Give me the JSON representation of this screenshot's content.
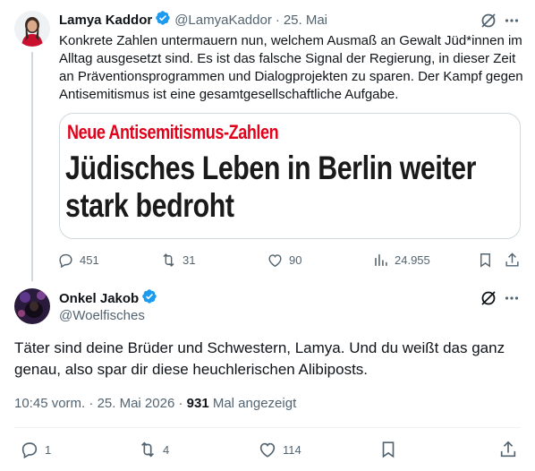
{
  "tweet1": {
    "display_name": "Lamya Kaddor",
    "handle": "@LamyaKaddor",
    "separator": "·",
    "date": "25. Mai",
    "text": "Konkrete Zahlen untermauern nun, welchem Ausmaß an Gewalt Jüd*innen im Alltag ausgesetzt sind. Es ist das falsche Signal der Regierung, in dieser Zeit an Präventionsprogrammen und Dialogprojekten zu sparen. Der Kampf gegen Antisemitismus ist eine gesamtgesellschaftliche Aufgabe.",
    "card": {
      "kicker": "Neue Antisemitismus-Zahlen",
      "headline": "Jüdisches Leben in Berlin weiter stark bedroht"
    },
    "stats": {
      "replies": "451",
      "reposts": "31",
      "likes": "90",
      "views": "24.955"
    }
  },
  "tweet2": {
    "display_name": "Onkel Jakob",
    "handle": "@Woelfisches",
    "text": "Täter sind deine Brüder und Schwestern, Lamya. Und du weißt das ganz genau, also spar dir diese heuchlerischen Alibiposts.",
    "time": "10:45 vorm.",
    "date": "25. Mai 2026",
    "separator": "·",
    "view_count": "931",
    "view_label": "Mal angezeigt",
    "stats": {
      "replies": "1",
      "reposts": "4",
      "likes": "114"
    }
  },
  "icons": {
    "verified": "verified-badge-icon",
    "grok": "grok-icon",
    "more": "more-icon",
    "reply": "reply-icon",
    "repost": "repost-icon",
    "like": "like-icon",
    "views": "views-icon",
    "bookmark": "bookmark-icon",
    "share": "share-icon"
  },
  "colors": {
    "verified": "#1d9bf0",
    "muted": "#536471",
    "kicker": "#e2001a"
  }
}
